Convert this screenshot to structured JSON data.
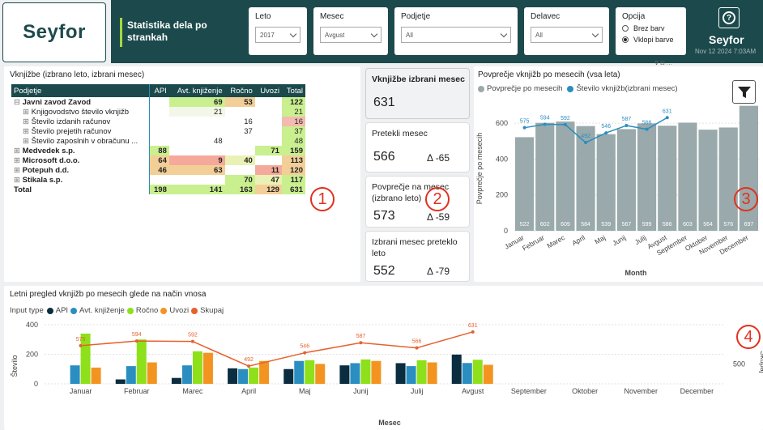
{
  "logo": "Seyfor",
  "header": {
    "title": "Statistika dela po strankah",
    "brand": "Seyfor",
    "timestamp": "Nov 12 2024 7:03AM"
  },
  "slicers": {
    "leto": {
      "label": "Leto",
      "value": "2017"
    },
    "mesec": {
      "label": "Mesec",
      "value": "Avgust"
    },
    "podjetje": {
      "label": "Podjetje",
      "value": "All"
    },
    "delavec": {
      "label": "Delavec",
      "value": "All"
    },
    "opcija": {
      "label": "Opcija",
      "options": [
        "Brez barv",
        "Vklopi barve"
      ],
      "selected": "Vklopi barve"
    }
  },
  "matrix": {
    "title": "Vknjižbe (izbrano leto, izbrani mesec)",
    "headers": [
      "Podjetje",
      "API",
      "Avt. knjiženje",
      "Ročno",
      "Uvozi",
      "Total"
    ],
    "rows": [
      {
        "name": "Javni zavod Zavod",
        "level": 0,
        "expand": "minus",
        "bold": true,
        "cells": [
          "",
          "69",
          "53",
          "",
          "122"
        ]
      },
      {
        "name": "Knjigovodstvo število vknjižb",
        "level": 1,
        "expand": "plus",
        "bold": false,
        "cells": [
          "",
          "21",
          "",
          "",
          "21"
        ]
      },
      {
        "name": "Število izdanih računov",
        "level": 1,
        "expand": "plus",
        "bold": false,
        "cells": [
          "",
          "",
          "16",
          "",
          "16"
        ]
      },
      {
        "name": "Število prejetih računov",
        "level": 1,
        "expand": "plus",
        "bold": false,
        "cells": [
          "",
          "",
          "37",
          "",
          "37"
        ]
      },
      {
        "name": "Število zaposlnih v obračunu ...",
        "level": 1,
        "expand": "plus",
        "bold": false,
        "cells": [
          "",
          "48",
          "",
          "",
          "48"
        ]
      },
      {
        "name": "Medvedek s.p.",
        "level": 0,
        "expand": "plus",
        "bold": true,
        "cells": [
          "88",
          "",
          "",
          "71",
          "159"
        ]
      },
      {
        "name": "Microsoft d.o.o.",
        "level": 0,
        "expand": "plus",
        "bold": true,
        "cells": [
          "64",
          "9",
          "40",
          "",
          "113"
        ]
      },
      {
        "name": "Potepuh d.d.",
        "level": 0,
        "expand": "plus",
        "bold": true,
        "cells": [
          "46",
          "63",
          "",
          "11",
          "120"
        ]
      },
      {
        "name": "Stikala s.p.",
        "level": 0,
        "expand": "plus",
        "bold": true,
        "cells": [
          "",
          "",
          "70",
          "47",
          "117"
        ]
      },
      {
        "name": "Total",
        "level": 0,
        "expand": "",
        "bold": true,
        "cells": [
          "198",
          "141",
          "163",
          "129",
          "631"
        ]
      }
    ],
    "cell_colors": [
      [
        "",
        "#c9ef8f",
        "#f3cf98",
        "",
        "#c9ef8f"
      ],
      [
        "",
        "#f3f7e9",
        "",
        "",
        "#c9ef8f"
      ],
      [
        "",
        "",
        "",
        "",
        "#f4b9b0"
      ],
      [
        "",
        "",
        "",
        "",
        "#c9ef8f"
      ],
      [
        "",
        "",
        "",
        "",
        "#c9ef8f"
      ],
      [
        "#c9ef8f",
        "",
        "",
        "#c9ef8f",
        "#c9ef8f"
      ],
      [
        "#f3cf98",
        "#f4a99a",
        "#e9f2b4",
        "",
        "#f3cf98"
      ],
      [
        "#f3cf98",
        "#f3cf98",
        "",
        "#f4a99a",
        "#f3cf98"
      ],
      [
        "",
        "",
        "#c9ef8f",
        "#e9f2b4",
        "#c9ef8f"
      ],
      [
        "#c9ef8f",
        "#c9ef8f",
        "#c9ef8f",
        "#f3cf98",
        "#c9ef8f"
      ]
    ]
  },
  "cards": [
    {
      "title": "Vknjižbe izbrani mesec",
      "value": "631",
      "delta": ""
    },
    {
      "title": "Pretekli mesec",
      "value": "566",
      "delta": "Δ -65"
    },
    {
      "title": "Povprečje na mesec (izbrano leto)",
      "value": "573",
      "delta": "Δ -59"
    },
    {
      "title": "Izbrani mesec preteklo leto",
      "value": "552",
      "delta": "Δ -79"
    }
  ],
  "markers": [
    "1",
    "2",
    "3",
    "4"
  ],
  "colors": {
    "header_bg": "#1c4a4c",
    "accent": "#a3d93b",
    "bar_gray": "#9aa9ab",
    "line_blue": "#2a8ec0",
    "api": "#0b2d40",
    "avt": "#2a8ec0",
    "rocno": "#8ee01a",
    "uvozi": "#f39420",
    "skupaj": "#e6622d",
    "marker": "#e0311e"
  },
  "chart_data": [
    {
      "type": "bar",
      "title": "Povprečje vknjižb po mesecih (vsa leta)",
      "categories": [
        "Januar",
        "Februar",
        "Marec",
        "April",
        "Maj",
        "Junij",
        "Julij",
        "Avgust",
        "September",
        "Oktober",
        "November",
        "December"
      ],
      "series": [
        {
          "name": "Povprečje po mesecih",
          "type": "bar",
          "values": [
            522,
            602,
            609,
            584,
            539,
            567,
            599,
            586,
            603,
            564,
            576,
            697
          ]
        },
        {
          "name": "Število vknjižb(izbrani mesec)",
          "type": "line",
          "values": [
            575,
            594,
            592,
            492,
            546,
            587,
            566,
            631,
            null,
            null,
            null,
            null
          ]
        }
      ],
      "xlabel": "Month",
      "ylabel": "Povprečje po mesecih",
      "ylim": [
        0,
        700
      ],
      "yticks": [
        0,
        200,
        400,
        600
      ],
      "legend": "top-left"
    },
    {
      "type": "bar",
      "title": "Letni pregled vknjižb po mesecih glede na način vnosa",
      "legend_title": "Input type",
      "categories": [
        "Januar",
        "Februar",
        "Marec",
        "April",
        "Maj",
        "Junij",
        "Julij",
        "Avgust",
        "September",
        "Oktober",
        "November",
        "December"
      ],
      "series": [
        {
          "name": "API",
          "values": [
            null,
            30,
            40,
            105,
            100,
            125,
            140,
            198,
            null,
            null,
            null,
            null
          ]
        },
        {
          "name": "Avt. knjiženje",
          "values": [
            125,
            120,
            125,
            100,
            155,
            140,
            120,
            141,
            null,
            null,
            null,
            null
          ]
        },
        {
          "name": "Ročno",
          "values": [
            340,
            300,
            220,
            110,
            160,
            165,
            160,
            163,
            null,
            null,
            null,
            null
          ]
        },
        {
          "name": "Uvozi",
          "values": [
            110,
            145,
            210,
            155,
            135,
            155,
            145,
            129,
            null,
            null,
            null,
            null
          ]
        },
        {
          "name": "Skupaj",
          "type": "line",
          "values": [
            575,
            594,
            592,
            492,
            546,
            587,
            566,
            631,
            null,
            null,
            null,
            null
          ]
        }
      ],
      "xlabel": "Mesec",
      "ylabel": "Število",
      "y2label": "Skupaj",
      "ylim": [
        0,
        400
      ],
      "yticks": [
        0,
        200,
        400
      ],
      "y2ticks": [
        500
      ],
      "legend": "top-left"
    }
  ]
}
